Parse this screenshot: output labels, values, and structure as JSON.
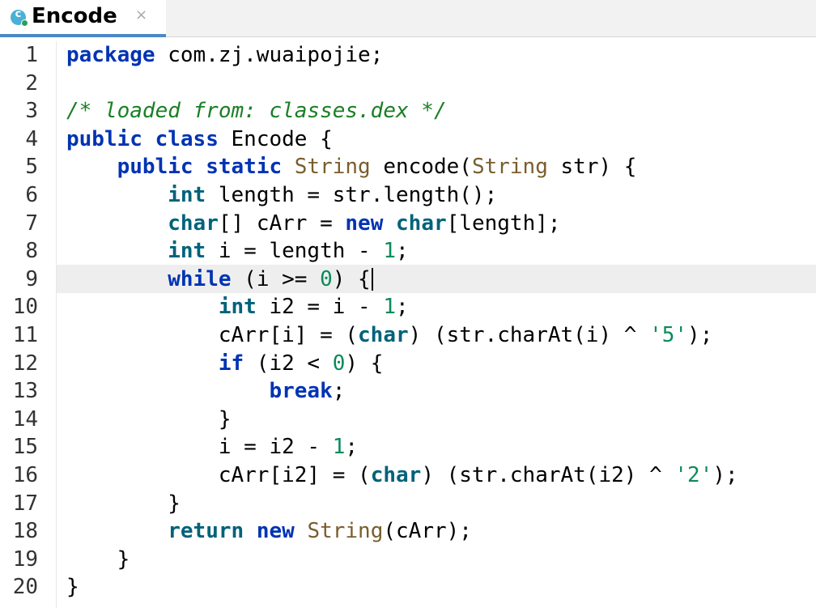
{
  "tab": {
    "title": "Encode",
    "icon": "java-class-icon",
    "close": "×"
  },
  "colors": {
    "keyword": "#0033b3",
    "type": "#7a5d2e",
    "number": "#0b8a5a",
    "comment": "#1a7f25",
    "tab_underline": "#4a88c7",
    "current_line": "#eeeeee"
  },
  "editor": {
    "line_numbers": [
      "1",
      "2",
      "3",
      "4",
      "5",
      "6",
      "7",
      "8",
      "9",
      "10",
      "11",
      "12",
      "13",
      "14",
      "15",
      "16",
      "17",
      "18",
      "19",
      "20"
    ],
    "current_line": 9,
    "code": {
      "l1_a": "package",
      "l1_b": " com.zj.wuaipojie;",
      "l3": "/* loaded from: classes.dex */",
      "l4_a": "public",
      "l4_b": "class",
      "l4_c": " Encode {",
      "l5_a": "public",
      "l5_b": "static",
      "l5_c": "String",
      "l5_d": " encode(",
      "l5_e": "String",
      "l5_f": " str) {",
      "l6_a": "int",
      "l6_b": " length = str.length();",
      "l7_a": "char",
      "l7_b": "[] cArr = ",
      "l7_c": "new",
      "l7_d": "char",
      "l7_e": "[length];",
      "l8_a": "int",
      "l8_b": " i = length - ",
      "l8_c": "1",
      "l8_d": ";",
      "l9_a": "while",
      "l9_b": " (i >= ",
      "l9_c": "0",
      "l9_d": ") {",
      "l10_a": "int",
      "l10_b": " i2 = i - ",
      "l10_c": "1",
      "l10_d": ";",
      "l11_a": "cArr[i] = (",
      "l11_b": "char",
      "l11_c": ") (str.charAt(i) ^ ",
      "l11_d": "'5'",
      "l11_e": ");",
      "l12_a": "if",
      "l12_b": " (i2 < ",
      "l12_c": "0",
      "l12_d": ") {",
      "l13": "break",
      "l13_b": ";",
      "l14": "}",
      "l15_a": "i = i2 - ",
      "l15_b": "1",
      "l15_c": ";",
      "l16_a": "cArr[i2] = (",
      "l16_b": "char",
      "l16_c": ") (str.charAt(i2) ^ ",
      "l16_d": "'2'",
      "l16_e": ");",
      "l17": "}",
      "l18_a": "return",
      "l18_b": "new",
      "l18_c": "String",
      "l18_d": "(cArr);",
      "l19": "}",
      "l20": "}"
    }
  }
}
